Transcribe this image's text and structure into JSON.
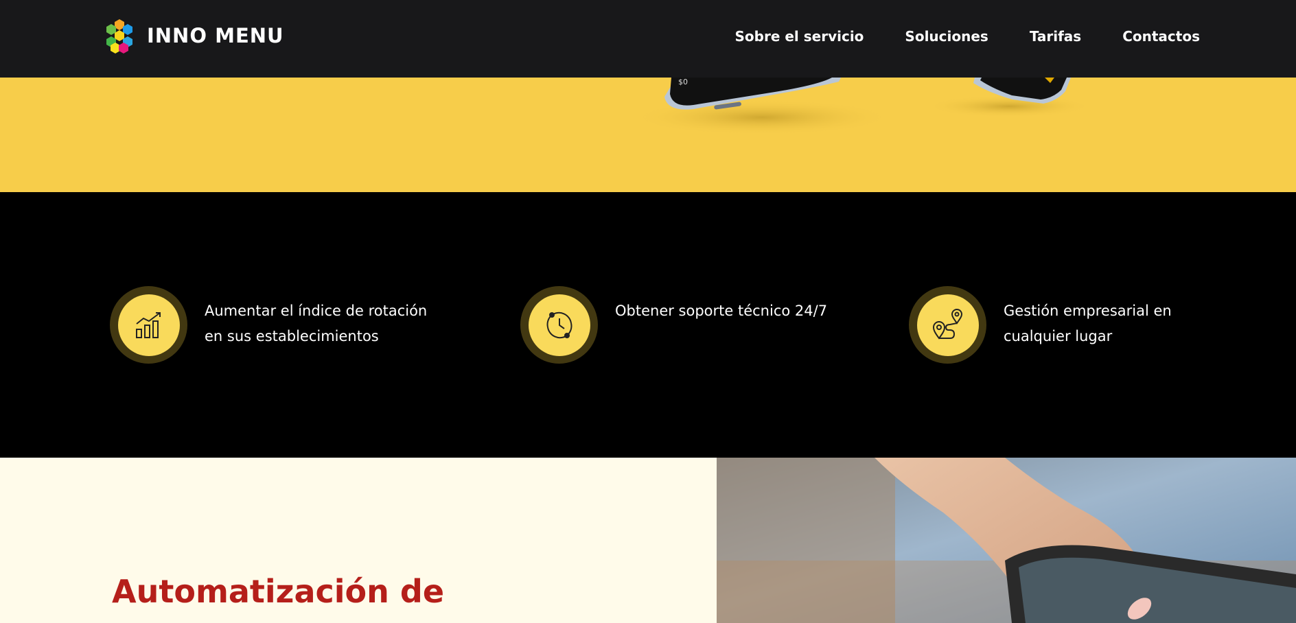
{
  "header": {
    "brand": "INNO MENU",
    "logo_icon": "hexagon-cluster-logo",
    "nav": [
      {
        "label": "Sobre el servicio"
      },
      {
        "label": "Soluciones"
      },
      {
        "label": "Tarifas"
      },
      {
        "label": "Contactos"
      }
    ]
  },
  "hero": {
    "background_color": "#f7cd4a",
    "image": "smartphones-photo"
  },
  "features": [
    {
      "icon": "growth-chart-icon",
      "text": "Aumentar el índice de rotación en sus establecimientos"
    },
    {
      "icon": "clock-support-icon",
      "text": "Obtener soporte técnico 24/7"
    },
    {
      "icon": "route-location-icon",
      "text": "Gestión empresarial en cualquier lugar"
    }
  ],
  "lower": {
    "heading": "Automatización de",
    "image": "hand-holding-phone-photo"
  },
  "colors": {
    "header_bg": "#18181a",
    "accent_yellow": "#f9da5b",
    "heading_red": "#b51f1a",
    "cream_bg": "#fffbea"
  }
}
